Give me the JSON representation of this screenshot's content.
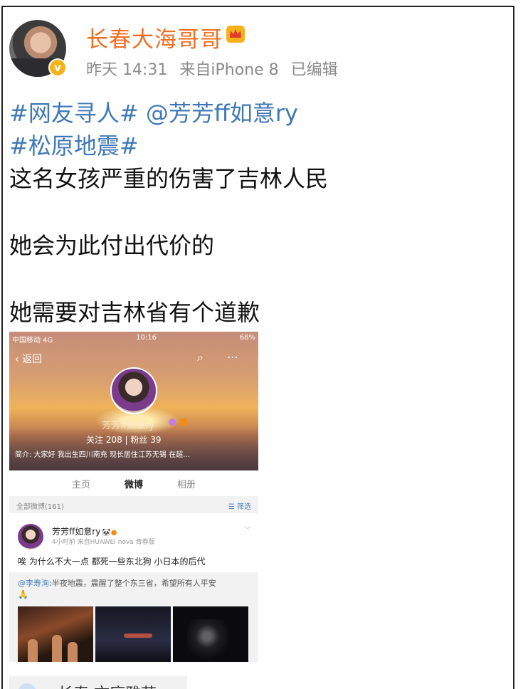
{
  "post": {
    "username": "长春大海哥哥",
    "time": "昨天 14:31",
    "source": "来自iPhone 8",
    "edited": "已编辑",
    "tags": [
      "#网友寻人#",
      "@芳芳ff如意ry",
      "#松原地震#"
    ],
    "lines": [
      "这名女孩严重的伤害了吉林人民",
      "她会为此付出代价的",
      "她需要对吉林省有个道歉"
    ],
    "location": "长春·文庭雅苑"
  },
  "embedded": {
    "status": {
      "carrier": "中国移动  4G",
      "time": "10:16",
      "battery": "68%"
    },
    "back_label": "返回",
    "profile_name": "芳芳ff如意ry",
    "follow_line": "关注  208  |  粉丝  39",
    "bio": "简介: 大家好  我出生四川南充  现长居住江苏无锡       在超...",
    "tabs": [
      "主页",
      "微博",
      "相册"
    ],
    "active_tab": "微博",
    "filter_left": "全部微博(161)",
    "filter_right": "筛选",
    "post_name": "芳芳ff如意ry",
    "post_time": "4小时前  来自HUAWEI nova 青春版",
    "post_text": "唉 为什么不大一点 都死一些东北狗 小日本的后代",
    "repost_at": "@李寿洵",
    "repost_text": ":半夜地震，震醒了整个东三省，希望所有人平安",
    "repost_emoji": "🙏"
  }
}
